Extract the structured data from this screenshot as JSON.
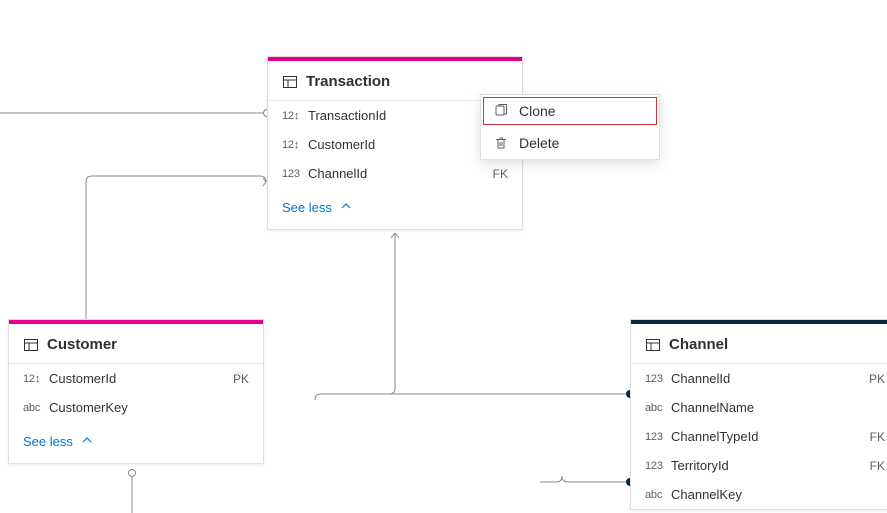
{
  "entities": {
    "transaction": {
      "title": "Transaction",
      "fields": [
        {
          "type": "12↕",
          "name": "TransactionId",
          "key": ""
        },
        {
          "type": "12↕",
          "name": "CustomerId",
          "key": ""
        },
        {
          "type": "123",
          "name": "ChannelId",
          "key": "FK"
        }
      ],
      "toggle": "See less"
    },
    "customer": {
      "title": "Customer",
      "fields": [
        {
          "type": "12↕",
          "name": "CustomerId",
          "key": "PK"
        },
        {
          "type": "abc",
          "name": "CustomerKey",
          "key": ""
        }
      ],
      "toggle": "See less"
    },
    "channel": {
      "title": "Channel",
      "fields": [
        {
          "type": "123",
          "name": "ChannelId",
          "key": "PK"
        },
        {
          "type": "abc",
          "name": "ChannelName",
          "key": ""
        },
        {
          "type": "123",
          "name": "ChannelTypeId",
          "key": "FK"
        },
        {
          "type": "123",
          "name": "TerritoryId",
          "key": "FK"
        },
        {
          "type": "abc",
          "name": "ChannelKey",
          "key": ""
        }
      ]
    }
  },
  "context_menu": {
    "clone": "Clone",
    "delete": "Delete"
  },
  "colors": {
    "pink": "#e3008c",
    "navy": "#0b2744",
    "link": "#0078d4"
  }
}
